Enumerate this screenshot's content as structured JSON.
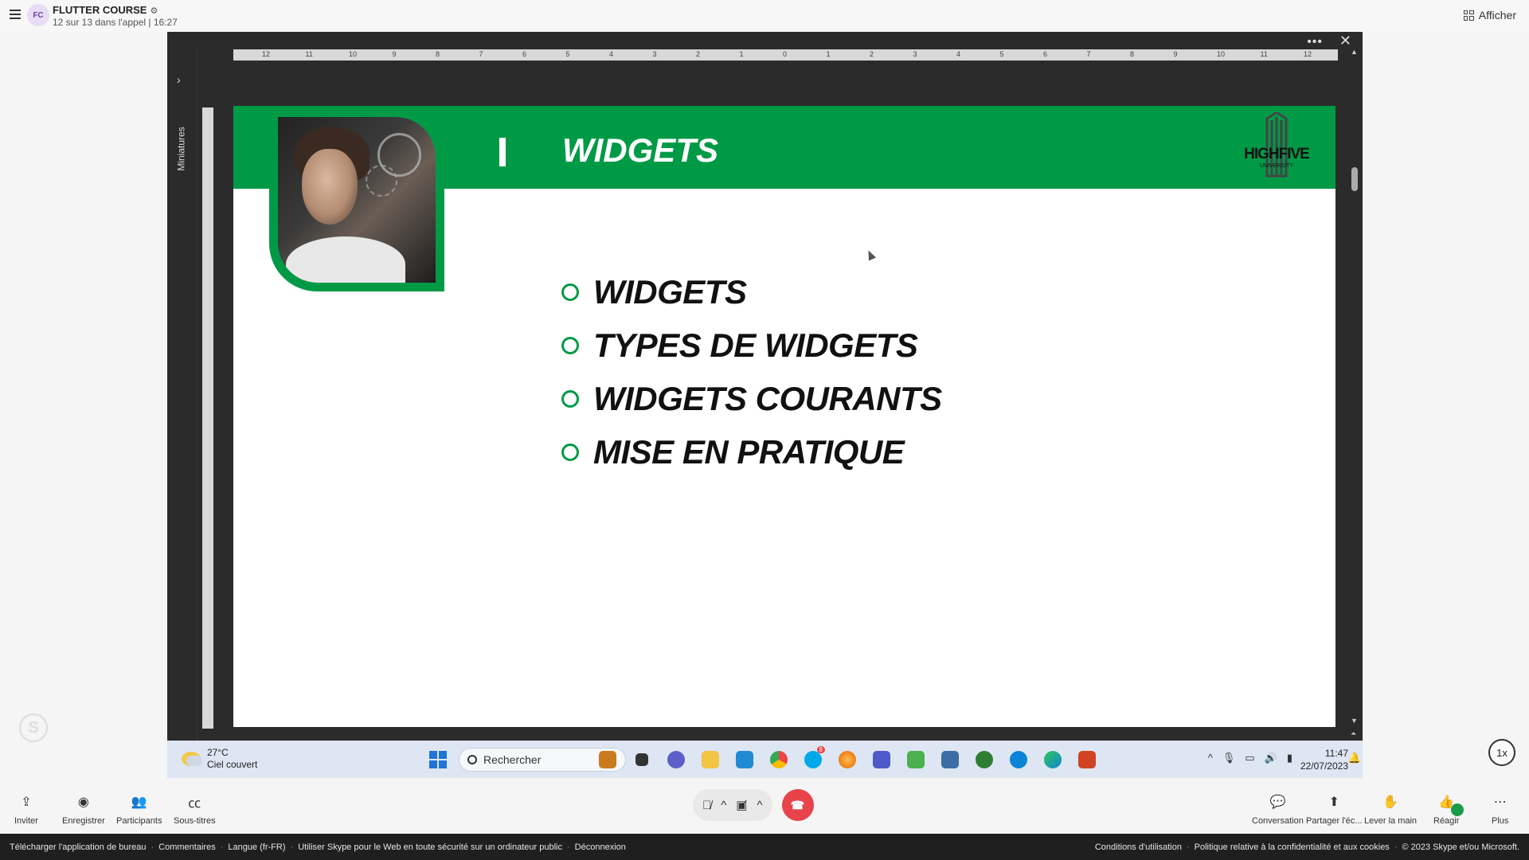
{
  "topbar": {
    "avatar_initials": "FC",
    "call_title": "FLUTTER COURSE",
    "call_subtitle": "12 sur 13 dans l'appel | 16:27",
    "view_label": "Afficher"
  },
  "share_panel": {
    "sidebar_label": "Miniatures",
    "menu_glyph": "•••",
    "close_glyph": "✕",
    "ruler_ticks": [
      "12",
      "11",
      "10",
      "9",
      "8",
      "7",
      "6",
      "5",
      "4",
      "3",
      "2",
      "1",
      "0",
      "1",
      "2",
      "3",
      "4",
      "5",
      "6",
      "7",
      "8",
      "9",
      "10",
      "11",
      "12"
    ]
  },
  "slide": {
    "title": "WIDGETS",
    "logo_text": "HIGHFIVE",
    "logo_subtext": "UNIVERSITY",
    "bullets": [
      "WIDGETS",
      "TYPES DE WIDGETS",
      "WIDGETS COURANTS",
      "MISE EN PRATIQUE"
    ],
    "accent_color": "#009a46"
  },
  "taskbar": {
    "weather_temp": "27°C",
    "weather_desc": "Ciel couvert",
    "search_placeholder": "Rechercher",
    "time": "11:47",
    "date": "22/07/2023",
    "skype_badge": "8",
    "apps": [
      "briefcase-icon",
      "task-view-icon",
      "chat-icon",
      "file-explorer-icon",
      "vscode-icon",
      "chrome-icon",
      "skype-icon",
      "firefox-icon",
      "teams-icon",
      "network-icon",
      "remote-desktop-icon",
      "hs-icon",
      "edge-blue-icon",
      "edge-icon",
      "powerpoint-icon"
    ]
  },
  "playback": {
    "speed": "1x"
  },
  "controls": {
    "invite": "Inviter",
    "record": "Enregistrer",
    "participants": "Participants",
    "subtitles": "Sous-titres",
    "conversation": "Conversation",
    "share_screen": "Partager l'éc...",
    "raise_hand": "Lever la main",
    "react": "Réagir",
    "more": "Plus"
  },
  "footer": {
    "left": [
      "Télécharger l'application de bureau",
      "Commentaires",
      "Langue (fr-FR)",
      "Utiliser Skype pour le Web en toute sécurité sur un ordinateur public",
      "Déconnexion"
    ],
    "right": [
      "Conditions d'utilisation",
      "Politique relative à la confidentialité et aux cookies",
      "© 2023 Skype et/ou Microsoft."
    ]
  }
}
